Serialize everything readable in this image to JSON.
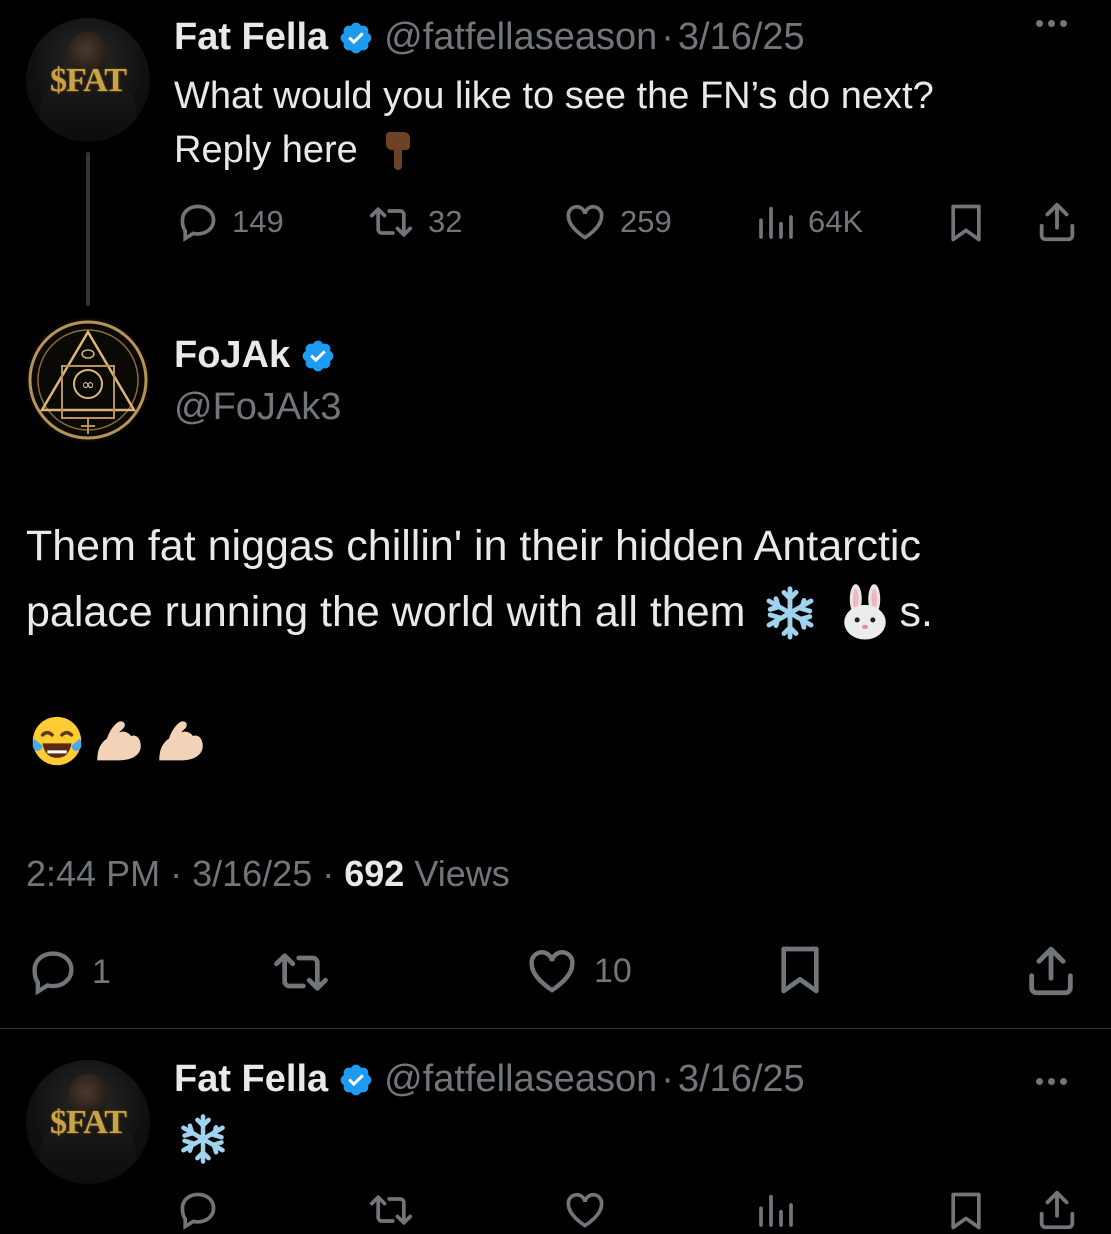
{
  "tweet1": {
    "name": "Fat Fella",
    "handle": "@fatfellaseason",
    "dot": "·",
    "date": "3/16/25",
    "line1": "What would you like to see the FN’s do next?",
    "line2": "Reply here",
    "avatar_text": "$FAT",
    "replies": "149",
    "retweets": "32",
    "likes": "259",
    "views": "64K"
  },
  "tweet2": {
    "name": "FoJAk",
    "handle": "@FoJAk3",
    "text_line1": "Them fat niggas chillin' in their hidden Antarctic",
    "text_line2_prefix": "palace running the world with all them",
    "text_line2_suffix": "s.",
    "time": "2:44 PM",
    "dot": "·",
    "date": "3/16/25",
    "views_count": "692",
    "views_label": "Views",
    "replies": "1",
    "likes": "10"
  },
  "tweet3": {
    "name": "Fat Fella",
    "handle": "@fatfellaseason",
    "dot": "·",
    "date": "3/16/25",
    "avatar_text": "$FAT"
  },
  "colors": {
    "background": "#000000",
    "text": "#e7e9ea",
    "muted": "#71767b",
    "verified": "#1d9bf0",
    "gold": "#c9a24a"
  }
}
